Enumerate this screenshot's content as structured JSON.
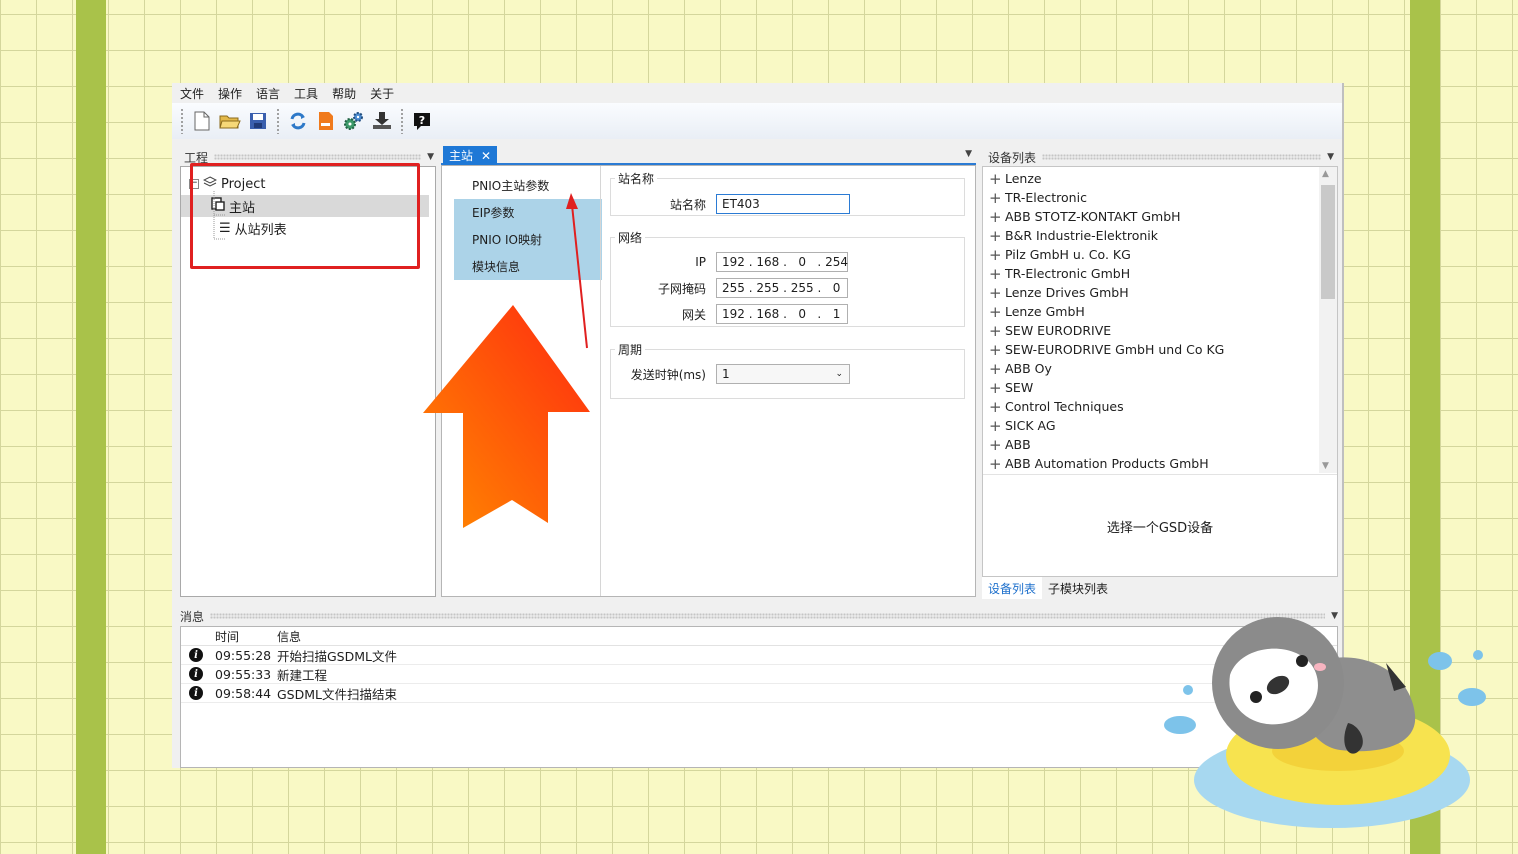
{
  "menu": [
    "文件",
    "操作",
    "语言",
    "工具",
    "帮助",
    "关于"
  ],
  "toolbar_icons": [
    "new-file-icon",
    "open-folder-icon",
    "save-icon",
    "refresh-icon",
    "document-icon",
    "settings-gears-icon",
    "download-icon",
    "help-icon"
  ],
  "project": {
    "title": "工程",
    "root": "Project",
    "children": [
      "主站",
      "从站列表"
    ]
  },
  "center": {
    "tab": "主站",
    "nav": [
      "PNIO主站参数",
      "EIP参数",
      "PNIO IO映射",
      "模块信息"
    ],
    "station_group": "站名称",
    "station_label": "站名称",
    "station_value": "ET403",
    "network_group": "网络",
    "ip_label": "IP",
    "ip": [
      "192",
      "168",
      "0",
      "254"
    ],
    "mask_label": "子网掩码",
    "mask": [
      "255",
      "255",
      "255",
      "0"
    ],
    "gateway_label": "网关",
    "gateway": [
      "192",
      "168",
      "0",
      "1"
    ],
    "cycle_group": "周期",
    "clock_label": "发送时钟(ms)",
    "clock_value": "1"
  },
  "devices": {
    "title": "设备列表",
    "items": [
      "Lenze",
      "TR-Electronic",
      "ABB STOTZ-KONTAKT GmbH",
      "B&R Industrie-Elektronik",
      "Pilz GmbH u. Co. KG",
      "TR-Electronic GmbH",
      "Lenze Drives GmbH",
      "Lenze GmbH",
      "SEW EURODRIVE",
      "SEW-EURODRIVE GmbH und Co KG",
      "ABB Oy",
      "SEW",
      "Control Techniques",
      "SICK AG",
      "ABB",
      "ABB Automation Products GmbH"
    ],
    "hint": "选择一个GSD设备",
    "tabs": [
      "设备列表",
      "子模块列表"
    ]
  },
  "messages": {
    "title": "消息",
    "col_time": "时间",
    "col_info": "信息",
    "rows": [
      {
        "time": "09:55:28",
        "text": "开始扫描GSDML文件"
      },
      {
        "time": "09:55:33",
        "text": "新建工程"
      },
      {
        "time": "09:58:44",
        "text": "GSDML文件扫描结束"
      }
    ]
  },
  "colors": {
    "background": "#f9f9c5",
    "stripe": "#a9c24a",
    "accent": "#1e78d6",
    "nav_bg": "#acd3e8",
    "highlight_box": "#e02020",
    "arrow_start": "#ff8a00",
    "arrow_end": "#ff2a10"
  }
}
